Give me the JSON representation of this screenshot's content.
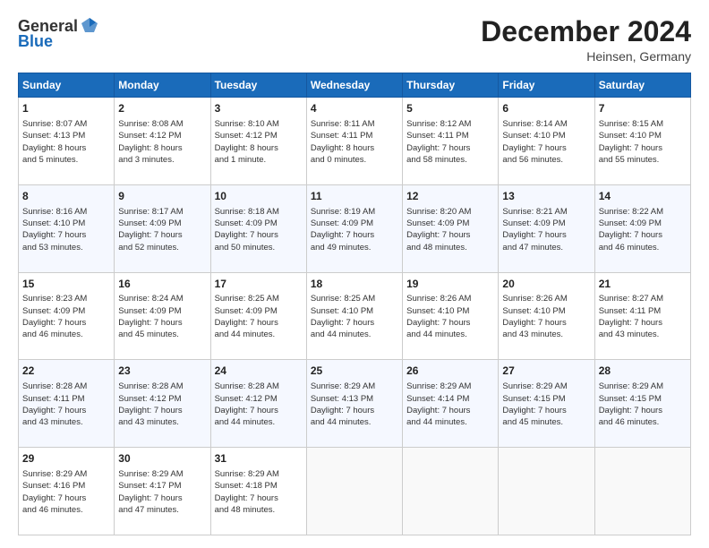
{
  "header": {
    "logo_general": "General",
    "logo_blue": "Blue",
    "title": "December 2024",
    "location": "Heinsen, Germany"
  },
  "days_of_week": [
    "Sunday",
    "Monday",
    "Tuesday",
    "Wednesday",
    "Thursday",
    "Friday",
    "Saturday"
  ],
  "weeks": [
    [
      {
        "day": 1,
        "lines": [
          "Sunrise: 8:07 AM",
          "Sunset: 4:13 PM",
          "Daylight: 8 hours",
          "and 5 minutes."
        ]
      },
      {
        "day": 2,
        "lines": [
          "Sunrise: 8:08 AM",
          "Sunset: 4:12 PM",
          "Daylight: 8 hours",
          "and 3 minutes."
        ]
      },
      {
        "day": 3,
        "lines": [
          "Sunrise: 8:10 AM",
          "Sunset: 4:12 PM",
          "Daylight: 8 hours",
          "and 1 minute."
        ]
      },
      {
        "day": 4,
        "lines": [
          "Sunrise: 8:11 AM",
          "Sunset: 4:11 PM",
          "Daylight: 8 hours",
          "and 0 minutes."
        ]
      },
      {
        "day": 5,
        "lines": [
          "Sunrise: 8:12 AM",
          "Sunset: 4:11 PM",
          "Daylight: 7 hours",
          "and 58 minutes."
        ]
      },
      {
        "day": 6,
        "lines": [
          "Sunrise: 8:14 AM",
          "Sunset: 4:10 PM",
          "Daylight: 7 hours",
          "and 56 minutes."
        ]
      },
      {
        "day": 7,
        "lines": [
          "Sunrise: 8:15 AM",
          "Sunset: 4:10 PM",
          "Daylight: 7 hours",
          "and 55 minutes."
        ]
      }
    ],
    [
      {
        "day": 8,
        "lines": [
          "Sunrise: 8:16 AM",
          "Sunset: 4:10 PM",
          "Daylight: 7 hours",
          "and 53 minutes."
        ]
      },
      {
        "day": 9,
        "lines": [
          "Sunrise: 8:17 AM",
          "Sunset: 4:09 PM",
          "Daylight: 7 hours",
          "and 52 minutes."
        ]
      },
      {
        "day": 10,
        "lines": [
          "Sunrise: 8:18 AM",
          "Sunset: 4:09 PM",
          "Daylight: 7 hours",
          "and 50 minutes."
        ]
      },
      {
        "day": 11,
        "lines": [
          "Sunrise: 8:19 AM",
          "Sunset: 4:09 PM",
          "Daylight: 7 hours",
          "and 49 minutes."
        ]
      },
      {
        "day": 12,
        "lines": [
          "Sunrise: 8:20 AM",
          "Sunset: 4:09 PM",
          "Daylight: 7 hours",
          "and 48 minutes."
        ]
      },
      {
        "day": 13,
        "lines": [
          "Sunrise: 8:21 AM",
          "Sunset: 4:09 PM",
          "Daylight: 7 hours",
          "and 47 minutes."
        ]
      },
      {
        "day": 14,
        "lines": [
          "Sunrise: 8:22 AM",
          "Sunset: 4:09 PM",
          "Daylight: 7 hours",
          "and 46 minutes."
        ]
      }
    ],
    [
      {
        "day": 15,
        "lines": [
          "Sunrise: 8:23 AM",
          "Sunset: 4:09 PM",
          "Daylight: 7 hours",
          "and 46 minutes."
        ]
      },
      {
        "day": 16,
        "lines": [
          "Sunrise: 8:24 AM",
          "Sunset: 4:09 PM",
          "Daylight: 7 hours",
          "and 45 minutes."
        ]
      },
      {
        "day": 17,
        "lines": [
          "Sunrise: 8:25 AM",
          "Sunset: 4:09 PM",
          "Daylight: 7 hours",
          "and 44 minutes."
        ]
      },
      {
        "day": 18,
        "lines": [
          "Sunrise: 8:25 AM",
          "Sunset: 4:10 PM",
          "Daylight: 7 hours",
          "and 44 minutes."
        ]
      },
      {
        "day": 19,
        "lines": [
          "Sunrise: 8:26 AM",
          "Sunset: 4:10 PM",
          "Daylight: 7 hours",
          "and 44 minutes."
        ]
      },
      {
        "day": 20,
        "lines": [
          "Sunrise: 8:26 AM",
          "Sunset: 4:10 PM",
          "Daylight: 7 hours",
          "and 43 minutes."
        ]
      },
      {
        "day": 21,
        "lines": [
          "Sunrise: 8:27 AM",
          "Sunset: 4:11 PM",
          "Daylight: 7 hours",
          "and 43 minutes."
        ]
      }
    ],
    [
      {
        "day": 22,
        "lines": [
          "Sunrise: 8:28 AM",
          "Sunset: 4:11 PM",
          "Daylight: 7 hours",
          "and 43 minutes."
        ]
      },
      {
        "day": 23,
        "lines": [
          "Sunrise: 8:28 AM",
          "Sunset: 4:12 PM",
          "Daylight: 7 hours",
          "and 43 minutes."
        ]
      },
      {
        "day": 24,
        "lines": [
          "Sunrise: 8:28 AM",
          "Sunset: 4:12 PM",
          "Daylight: 7 hours",
          "and 44 minutes."
        ]
      },
      {
        "day": 25,
        "lines": [
          "Sunrise: 8:29 AM",
          "Sunset: 4:13 PM",
          "Daylight: 7 hours",
          "and 44 minutes."
        ]
      },
      {
        "day": 26,
        "lines": [
          "Sunrise: 8:29 AM",
          "Sunset: 4:14 PM",
          "Daylight: 7 hours",
          "and 44 minutes."
        ]
      },
      {
        "day": 27,
        "lines": [
          "Sunrise: 8:29 AM",
          "Sunset: 4:15 PM",
          "Daylight: 7 hours",
          "and 45 minutes."
        ]
      },
      {
        "day": 28,
        "lines": [
          "Sunrise: 8:29 AM",
          "Sunset: 4:15 PM",
          "Daylight: 7 hours",
          "and 46 minutes."
        ]
      }
    ],
    [
      {
        "day": 29,
        "lines": [
          "Sunrise: 8:29 AM",
          "Sunset: 4:16 PM",
          "Daylight: 7 hours",
          "and 46 minutes."
        ]
      },
      {
        "day": 30,
        "lines": [
          "Sunrise: 8:29 AM",
          "Sunset: 4:17 PM",
          "Daylight: 7 hours",
          "and 47 minutes."
        ]
      },
      {
        "day": 31,
        "lines": [
          "Sunrise: 8:29 AM",
          "Sunset: 4:18 PM",
          "Daylight: 7 hours",
          "and 48 minutes."
        ]
      },
      null,
      null,
      null,
      null
    ]
  ]
}
